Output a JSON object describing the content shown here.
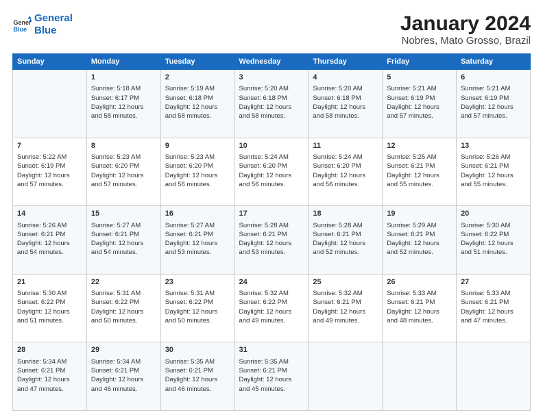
{
  "logo": {
    "line1": "General",
    "line2": "Blue"
  },
  "title": "January 2024",
  "subtitle": "Nobres, Mato Grosso, Brazil",
  "columns": [
    "Sunday",
    "Monday",
    "Tuesday",
    "Wednesday",
    "Thursday",
    "Friday",
    "Saturday"
  ],
  "weeks": [
    [
      {
        "day": "",
        "info": ""
      },
      {
        "day": "1",
        "info": "Sunrise: 5:18 AM\nSunset: 6:17 PM\nDaylight: 12 hours\nand 58 minutes."
      },
      {
        "day": "2",
        "info": "Sunrise: 5:19 AM\nSunset: 6:18 PM\nDaylight: 12 hours\nand 58 minutes."
      },
      {
        "day": "3",
        "info": "Sunrise: 5:20 AM\nSunset: 6:18 PM\nDaylight: 12 hours\nand 58 minutes."
      },
      {
        "day": "4",
        "info": "Sunrise: 5:20 AM\nSunset: 6:18 PM\nDaylight: 12 hours\nand 58 minutes."
      },
      {
        "day": "5",
        "info": "Sunrise: 5:21 AM\nSunset: 6:19 PM\nDaylight: 12 hours\nand 57 minutes."
      },
      {
        "day": "6",
        "info": "Sunrise: 5:21 AM\nSunset: 6:19 PM\nDaylight: 12 hours\nand 57 minutes."
      }
    ],
    [
      {
        "day": "7",
        "info": "Sunrise: 5:22 AM\nSunset: 6:19 PM\nDaylight: 12 hours\nand 57 minutes."
      },
      {
        "day": "8",
        "info": "Sunrise: 5:23 AM\nSunset: 6:20 PM\nDaylight: 12 hours\nand 57 minutes."
      },
      {
        "day": "9",
        "info": "Sunrise: 5:23 AM\nSunset: 6:20 PM\nDaylight: 12 hours\nand 56 minutes."
      },
      {
        "day": "10",
        "info": "Sunrise: 5:24 AM\nSunset: 6:20 PM\nDaylight: 12 hours\nand 56 minutes."
      },
      {
        "day": "11",
        "info": "Sunrise: 5:24 AM\nSunset: 6:20 PM\nDaylight: 12 hours\nand 56 minutes."
      },
      {
        "day": "12",
        "info": "Sunrise: 5:25 AM\nSunset: 6:21 PM\nDaylight: 12 hours\nand 55 minutes."
      },
      {
        "day": "13",
        "info": "Sunrise: 5:26 AM\nSunset: 6:21 PM\nDaylight: 12 hours\nand 55 minutes."
      }
    ],
    [
      {
        "day": "14",
        "info": "Sunrise: 5:26 AM\nSunset: 6:21 PM\nDaylight: 12 hours\nand 54 minutes."
      },
      {
        "day": "15",
        "info": "Sunrise: 5:27 AM\nSunset: 6:21 PM\nDaylight: 12 hours\nand 54 minutes."
      },
      {
        "day": "16",
        "info": "Sunrise: 5:27 AM\nSunset: 6:21 PM\nDaylight: 12 hours\nand 53 minutes."
      },
      {
        "day": "17",
        "info": "Sunrise: 5:28 AM\nSunset: 6:21 PM\nDaylight: 12 hours\nand 53 minutes."
      },
      {
        "day": "18",
        "info": "Sunrise: 5:28 AM\nSunset: 6:21 PM\nDaylight: 12 hours\nand 52 minutes."
      },
      {
        "day": "19",
        "info": "Sunrise: 5:29 AM\nSunset: 6:21 PM\nDaylight: 12 hours\nand 52 minutes."
      },
      {
        "day": "20",
        "info": "Sunrise: 5:30 AM\nSunset: 6:22 PM\nDaylight: 12 hours\nand 51 minutes."
      }
    ],
    [
      {
        "day": "21",
        "info": "Sunrise: 5:30 AM\nSunset: 6:22 PM\nDaylight: 12 hours\nand 51 minutes."
      },
      {
        "day": "22",
        "info": "Sunrise: 5:31 AM\nSunset: 6:22 PM\nDaylight: 12 hours\nand 50 minutes."
      },
      {
        "day": "23",
        "info": "Sunrise: 5:31 AM\nSunset: 6:22 PM\nDaylight: 12 hours\nand 50 minutes."
      },
      {
        "day": "24",
        "info": "Sunrise: 5:32 AM\nSunset: 6:22 PM\nDaylight: 12 hours\nand 49 minutes."
      },
      {
        "day": "25",
        "info": "Sunrise: 5:32 AM\nSunset: 6:21 PM\nDaylight: 12 hours\nand 49 minutes."
      },
      {
        "day": "26",
        "info": "Sunrise: 5:33 AM\nSunset: 6:21 PM\nDaylight: 12 hours\nand 48 minutes."
      },
      {
        "day": "27",
        "info": "Sunrise: 5:33 AM\nSunset: 6:21 PM\nDaylight: 12 hours\nand 47 minutes."
      }
    ],
    [
      {
        "day": "28",
        "info": "Sunrise: 5:34 AM\nSunset: 6:21 PM\nDaylight: 12 hours\nand 47 minutes."
      },
      {
        "day": "29",
        "info": "Sunrise: 5:34 AM\nSunset: 6:21 PM\nDaylight: 12 hours\nand 46 minutes."
      },
      {
        "day": "30",
        "info": "Sunrise: 5:35 AM\nSunset: 6:21 PM\nDaylight: 12 hours\nand 46 minutes."
      },
      {
        "day": "31",
        "info": "Sunrise: 5:35 AM\nSunset: 6:21 PM\nDaylight: 12 hours\nand 45 minutes."
      },
      {
        "day": "",
        "info": ""
      },
      {
        "day": "",
        "info": ""
      },
      {
        "day": "",
        "info": ""
      }
    ]
  ]
}
